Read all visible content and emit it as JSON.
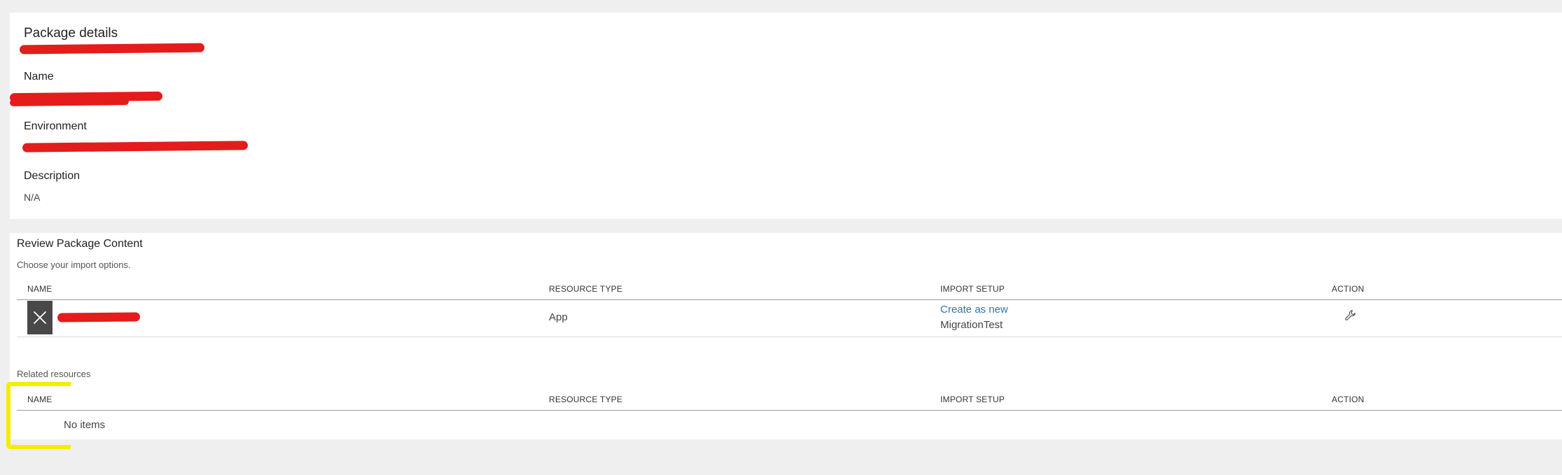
{
  "package_details": {
    "title": "Package details",
    "name_label": "Name",
    "environment_label": "Environment",
    "description_label": "Description",
    "description_value": "N/A"
  },
  "review": {
    "title": "Review Package Content",
    "subtitle": "Choose your import options.",
    "columns": [
      "NAME",
      "RESOURCE TYPE",
      "IMPORT SETUP",
      "ACTION"
    ],
    "rows": [
      {
        "resource_type": "App",
        "import_action": "Create as new",
        "import_target": "MigrationTest",
        "action_icon": "wrench-icon"
      }
    ],
    "app_icon": "close-x-icon"
  },
  "related": {
    "title": "Related resources",
    "columns": [
      "NAME",
      "RESOURCE TYPE",
      "IMPORT SETUP",
      "ACTION"
    ],
    "empty_text": "No items"
  },
  "colors": {
    "link": "#2e75b6",
    "redaction": "#e41c1c",
    "highlight": "#f5ec00",
    "app_tile": "#484848"
  }
}
